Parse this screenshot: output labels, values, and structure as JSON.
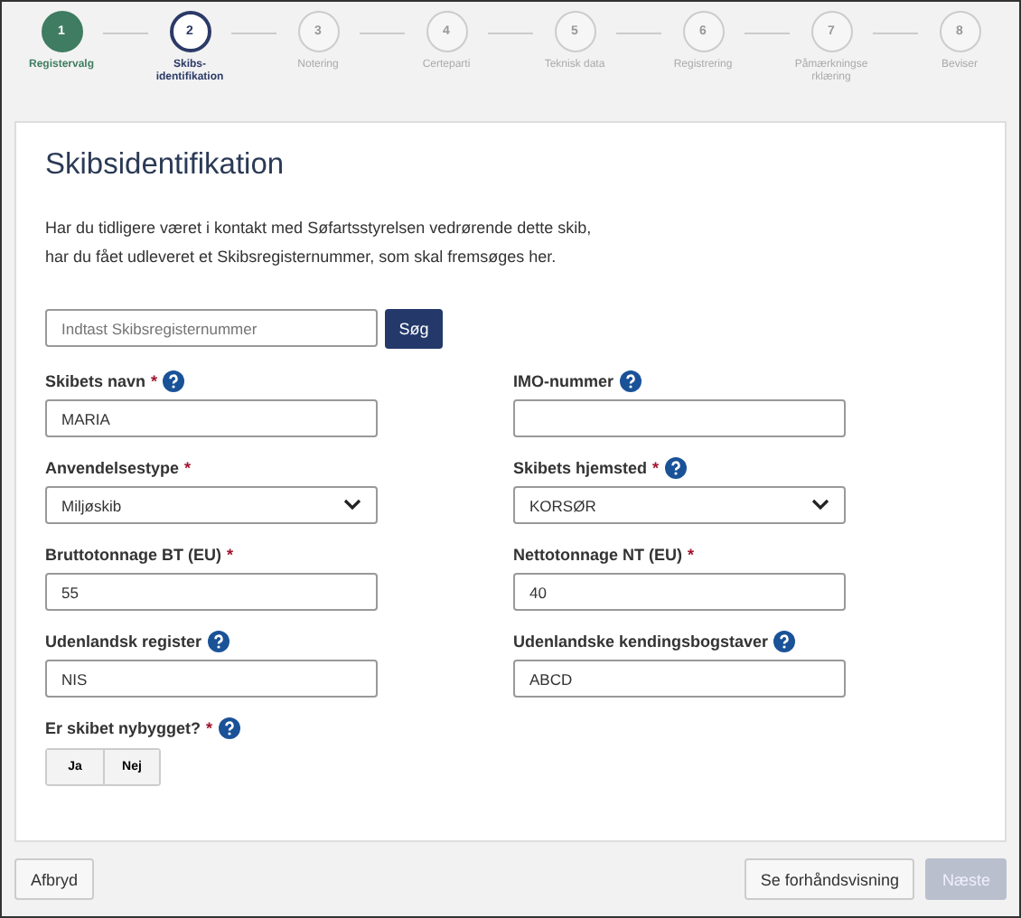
{
  "steps": [
    {
      "number": "1",
      "label": "Registervalg",
      "completed": true,
      "selected": false
    },
    {
      "number": "2",
      "label": "Skibs-\nidentifikation",
      "completed": false,
      "selected": true
    },
    {
      "number": "3",
      "label": "Notering",
      "completed": false,
      "selected": false
    },
    {
      "number": "4",
      "label": "Certeparti",
      "completed": false,
      "selected": false
    },
    {
      "number": "5",
      "label": "Teknisk data",
      "completed": false,
      "selected": false
    },
    {
      "number": "6",
      "label": "Registrering",
      "completed": false,
      "selected": false
    },
    {
      "number": "7",
      "label": "Påmærkningse\nrklæring",
      "completed": false,
      "selected": false
    },
    {
      "number": "8",
      "label": "Beviser",
      "completed": false,
      "selected": false
    }
  ],
  "card": {
    "title": "Skibsidentifikation",
    "intro": [
      "Har du tidligere været i kontakt med Søfartsstyrelsen vedrørende dette skib,",
      "har du fået udleveret et Skibsregisternummer, som skal fremsøges her."
    ],
    "search": {
      "placeholder": "Indtast Skibsregisternummer",
      "button": "Søg"
    },
    "fields": [
      {
        "label": "Skibets navn",
        "required_mark": "*",
        "help": true,
        "kind": "text",
        "value": "MARIA"
      },
      {
        "label": "IMO-nummer",
        "help": true,
        "kind": "text"
      },
      {
        "label": "Anvendelsestype",
        "required_mark": "*",
        "help": false,
        "kind": "select",
        "value": "Miljøskib"
      },
      {
        "label": "Skibets hjemsted",
        "required_mark": "*",
        "help": true,
        "kind": "select",
        "value": "KORSØR"
      },
      {
        "label": "Bruttotonnage BT (EU)",
        "required_mark": "*",
        "help": false,
        "kind": "text",
        "value": "55"
      },
      {
        "label": "Nettotonnage NT (EU)",
        "required_mark": "*",
        "help": false,
        "kind": "text",
        "value": "40"
      },
      {
        "label": "Udenlandsk register",
        "help": true,
        "kind": "text",
        "value": "NIS"
      },
      {
        "label": "Udenlandske kendingsbogstaver",
        "help": true,
        "kind": "text",
        "value": "ABCD"
      }
    ],
    "question": {
      "label": "Er skibet nybygget?",
      "required_mark": "*",
      "help": true,
      "options": [
        {
          "label": "Ja",
          "selected": false
        },
        {
          "label": "Nej",
          "selected": false
        }
      ]
    }
  },
  "footer": {
    "cancel": "Afbryd",
    "preview": "Se forhåndsvisning",
    "next": {
      "label": "Næste",
      "disabled": true
    }
  }
}
